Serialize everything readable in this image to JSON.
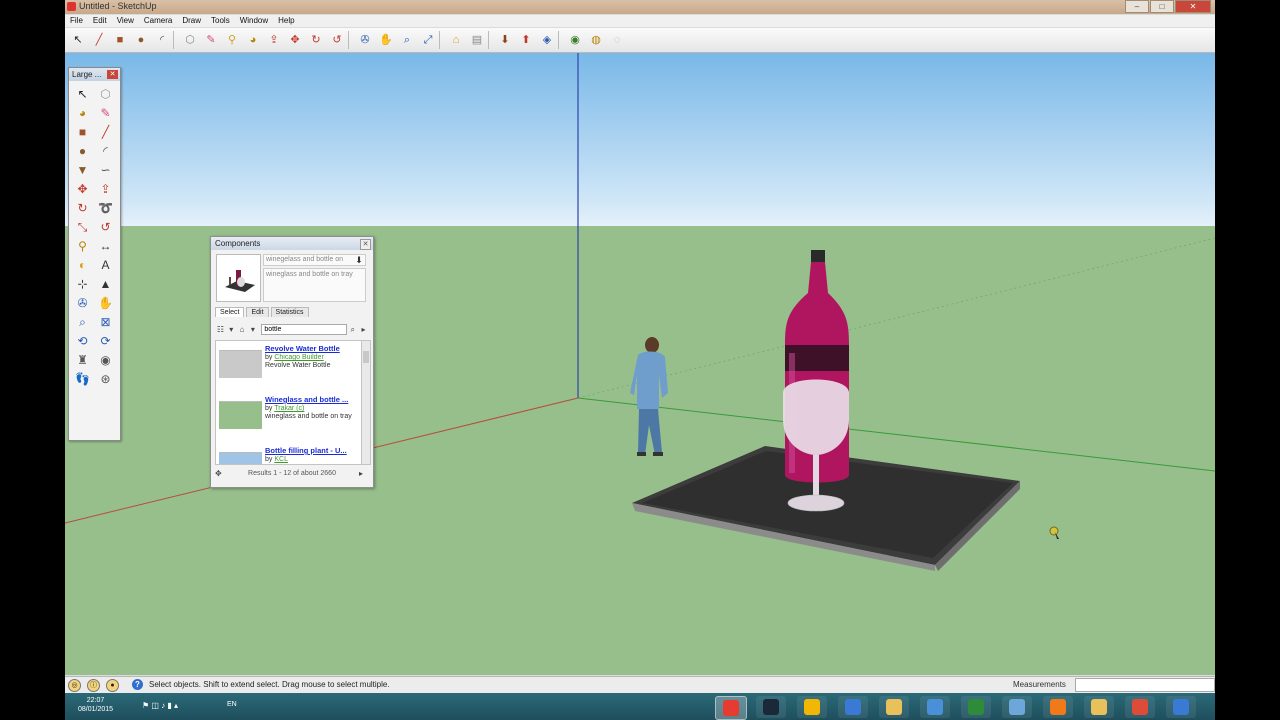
{
  "window": {
    "title": "Untitled - SketchUp",
    "controls": {
      "minimize": "–",
      "maximize": "□",
      "close": "✕"
    }
  },
  "menu": [
    "File",
    "Edit",
    "View",
    "Camera",
    "Draw",
    "Tools",
    "Window",
    "Help"
  ],
  "toolbar": [
    {
      "name": "select-tool-icon",
      "glyph": "↖",
      "color": "#222"
    },
    {
      "name": "line-tool-icon",
      "glyph": "╱",
      "color": "#c0392b"
    },
    {
      "name": "rectangle-tool-icon",
      "glyph": "■",
      "color": "#a0522d"
    },
    {
      "name": "circle-tool-icon",
      "glyph": "●",
      "color": "#8b5a2b"
    },
    {
      "name": "arc-tool-icon",
      "glyph": "◜",
      "color": "#555"
    },
    {
      "name": "make-component-icon",
      "glyph": "⬡",
      "color": "#888"
    },
    {
      "name": "eraser-icon",
      "glyph": "✎",
      "color": "#d64b7a"
    },
    {
      "name": "tape-measure-icon",
      "glyph": "⚲",
      "color": "#d4a017"
    },
    {
      "name": "paint-bucket-icon",
      "glyph": "◕",
      "color": "#b8860b"
    },
    {
      "name": "push-pull-icon",
      "glyph": "⇪",
      "color": "#c0392b"
    },
    {
      "name": "move-tool-icon",
      "glyph": "✥",
      "color": "#c0392b"
    },
    {
      "name": "rotate-tool-icon",
      "glyph": "↻",
      "color": "#c0392b"
    },
    {
      "name": "offset-tool-icon",
      "glyph": "↺",
      "color": "#c0392b"
    },
    {
      "name": "orbit-tool-icon",
      "glyph": "✇",
      "color": "#2a5db0"
    },
    {
      "name": "pan-tool-icon",
      "glyph": "✋",
      "color": "#2a5db0"
    },
    {
      "name": "zoom-tool-icon",
      "glyph": "⌕",
      "color": "#2a5db0"
    },
    {
      "name": "zoom-extents-icon",
      "glyph": "⤢",
      "color": "#2a5db0"
    },
    {
      "name": "warehouse-icon",
      "glyph": "⌂",
      "color": "#d4a017"
    },
    {
      "name": "share-model-icon",
      "glyph": "▤",
      "color": "#888"
    },
    {
      "name": "get-models-icon",
      "glyph": "⬇",
      "color": "#8b4513"
    },
    {
      "name": "share-component-icon",
      "glyph": "⬆",
      "color": "#c0392b"
    },
    {
      "name": "extension-warehouse-icon",
      "glyph": "◈",
      "color": "#2a5db0"
    },
    {
      "name": "styles-icon",
      "glyph": "◉",
      "color": "#3a7d2a"
    },
    {
      "name": "materials-icon",
      "glyph": "◍",
      "color": "#b8860b"
    },
    {
      "name": "add-location-icon",
      "glyph": "◌",
      "color": "#aaa"
    }
  ],
  "palette": {
    "title": "Large ...",
    "close": "✕",
    "tools": [
      {
        "name": "select-icon",
        "glyph": "↖",
        "color": "#222"
      },
      {
        "name": "make-component-icon",
        "glyph": "⬡",
        "color": "#999"
      },
      {
        "name": "paint-bucket-icon",
        "glyph": "◕",
        "color": "#b8860b"
      },
      {
        "name": "eraser-icon",
        "glyph": "✎",
        "color": "#d64b7a"
      },
      {
        "name": "rectangle-icon",
        "glyph": "■",
        "color": "#a0522d"
      },
      {
        "name": "line-icon",
        "glyph": "╱",
        "color": "#c0392b"
      },
      {
        "name": "circle-icon",
        "glyph": "●",
        "color": "#8b5a2b"
      },
      {
        "name": "arc-icon",
        "glyph": "◜",
        "color": "#555"
      },
      {
        "name": "polygon-icon",
        "glyph": "▼",
        "color": "#8b5a2b"
      },
      {
        "name": "freehand-icon",
        "glyph": "∽",
        "color": "#555"
      },
      {
        "name": "move-icon",
        "glyph": "✥",
        "color": "#c0392b"
      },
      {
        "name": "push-pull-icon",
        "glyph": "⇪",
        "color": "#c0392b"
      },
      {
        "name": "rotate-icon",
        "glyph": "↻",
        "color": "#c0392b"
      },
      {
        "name": "follow-me-icon",
        "glyph": "➰",
        "color": "#c0392b"
      },
      {
        "name": "scale-icon",
        "glyph": "⤡",
        "color": "#c0392b"
      },
      {
        "name": "offset-icon",
        "glyph": "↺",
        "color": "#c0392b"
      },
      {
        "name": "tape-measure-icon",
        "glyph": "⚲",
        "color": "#b8860b"
      },
      {
        "name": "dimension-icon",
        "glyph": "↔",
        "color": "#333"
      },
      {
        "name": "protractor-icon",
        "glyph": "◐",
        "color": "#d4a017"
      },
      {
        "name": "text-icon",
        "glyph": "A",
        "color": "#333"
      },
      {
        "name": "axes-icon",
        "glyph": "⊹",
        "color": "#333"
      },
      {
        "name": "3d-text-icon",
        "glyph": "▲",
        "color": "#333"
      },
      {
        "name": "orbit-icon",
        "glyph": "✇",
        "color": "#2a5db0"
      },
      {
        "name": "pan-icon",
        "glyph": "✋",
        "color": "#888"
      },
      {
        "name": "zoom-icon",
        "glyph": "⌕",
        "color": "#2a5db0"
      },
      {
        "name": "zoom-window-icon",
        "glyph": "⊠",
        "color": "#2a5db0"
      },
      {
        "name": "previous-view-icon",
        "glyph": "⟲",
        "color": "#2a5db0"
      },
      {
        "name": "next-view-icon",
        "glyph": "⟳",
        "color": "#2a5db0"
      },
      {
        "name": "position-camera-icon",
        "glyph": "♜",
        "color": "#555"
      },
      {
        "name": "look-around-icon",
        "glyph": "◉",
        "color": "#555"
      },
      {
        "name": "walk-icon",
        "glyph": "👣",
        "color": "#333"
      },
      {
        "name": "section-plane-icon",
        "glyph": "⊛",
        "color": "#555"
      }
    ]
  },
  "components": {
    "title": "Components",
    "close": "✕",
    "selected_name": "winegelass and bottle on",
    "selected_description": "wineglass and bottle on tray",
    "tabs": [
      "Select",
      "Edit",
      "Statistics"
    ],
    "search_value": "bottle",
    "items": [
      {
        "name": "Revolve Water Bottle",
        "by": "by",
        "author": "Chicago Builder",
        "description": "Revolve Water Bottle",
        "thumb": "#c9c9c9"
      },
      {
        "name": "Wineglass and bottle ...",
        "by": "by",
        "author": "Trakar (c)",
        "description": "wineglass and bottle on tray",
        "thumb": "#97bf8b"
      },
      {
        "name": "Bottle filling plant - U...",
        "by": "by",
        "author": "KCL",
        "description": "",
        "thumb": "#9fc4e6"
      }
    ],
    "results": "Results 1 - 12 of about 2660"
  },
  "status": {
    "hint": "Select objects. Shift to extend select. Drag mouse to select multiple.",
    "measurements_label": "Measurements",
    "measurements_value": ""
  },
  "taskbar": {
    "time": "22:07",
    "date": "08/01/2015",
    "lang": "EN",
    "apps": [
      {
        "name": "taskbar-sketchup-icon",
        "color": "#e53b30",
        "active": true
      },
      {
        "name": "taskbar-steam-icon",
        "color": "#1b2838",
        "active": false
      },
      {
        "name": "taskbar-app-icon",
        "color": "#f2b705",
        "active": false
      },
      {
        "name": "taskbar-media-icon",
        "color": "#3a79d4",
        "active": false
      },
      {
        "name": "taskbar-folder-icon",
        "color": "#e8c15a",
        "active": false
      },
      {
        "name": "taskbar-paint-icon",
        "color": "#4a90d9",
        "active": false
      },
      {
        "name": "taskbar-excel-icon",
        "color": "#2e8b3a",
        "active": false
      },
      {
        "name": "taskbar-explorer-icon",
        "color": "#6da6d8",
        "active": false
      },
      {
        "name": "taskbar-player-icon",
        "color": "#f07a1a",
        "active": false
      },
      {
        "name": "taskbar-files-icon",
        "color": "#e8c15a",
        "active": false
      },
      {
        "name": "taskbar-chrome-icon",
        "color": "#dd4b39",
        "active": false
      },
      {
        "name": "taskbar-firefox-icon",
        "color": "#3a79d4",
        "active": false
      }
    ]
  },
  "scene": {
    "sky_color": "#79b8e8",
    "ground_color": "#97bf8b",
    "bottle_color": "#b01560",
    "tray_color": "#4a4a4a"
  }
}
